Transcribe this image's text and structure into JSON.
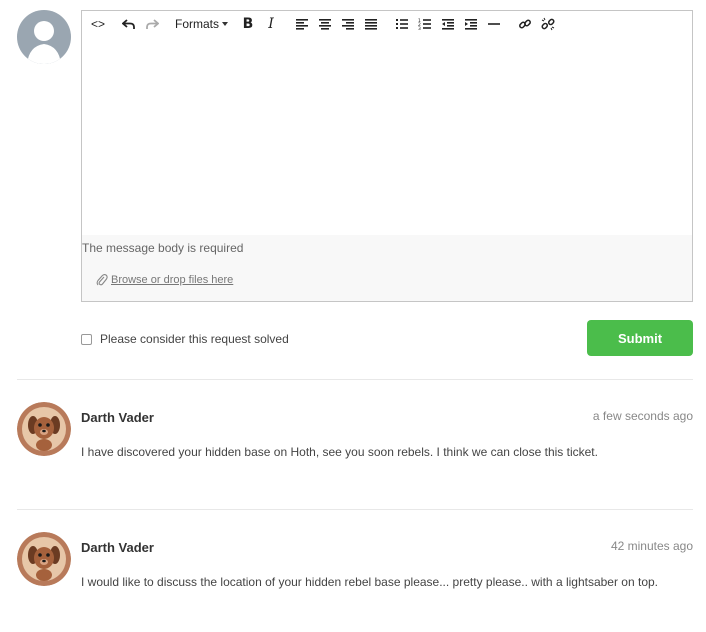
{
  "editor": {
    "toolbar": {
      "source_code_label": "<>",
      "formats_label": "Formats",
      "bold_label": "B",
      "italic_label": "I"
    },
    "error_message": "The message body is required",
    "attach_label": "Browse or drop files here"
  },
  "form": {
    "solved_label": "Please consider this request solved",
    "submit_label": "Submit"
  },
  "comments": [
    {
      "author": "Darth Vader",
      "time": "a few seconds ago",
      "body": "I have discovered your hidden base on Hoth, see you soon rebels. I think we can close this ticket."
    },
    {
      "author": "Darth Vader",
      "time": "42 minutes ago",
      "body": "I would like to discuss the location of your hidden rebel base please... pretty please.. with a lightsaber on top."
    }
  ],
  "colors": {
    "submit": "#4bbd4b",
    "avatar_placeholder": "#9aa6b1",
    "avatar_dog_bg": "#b87a5a"
  }
}
